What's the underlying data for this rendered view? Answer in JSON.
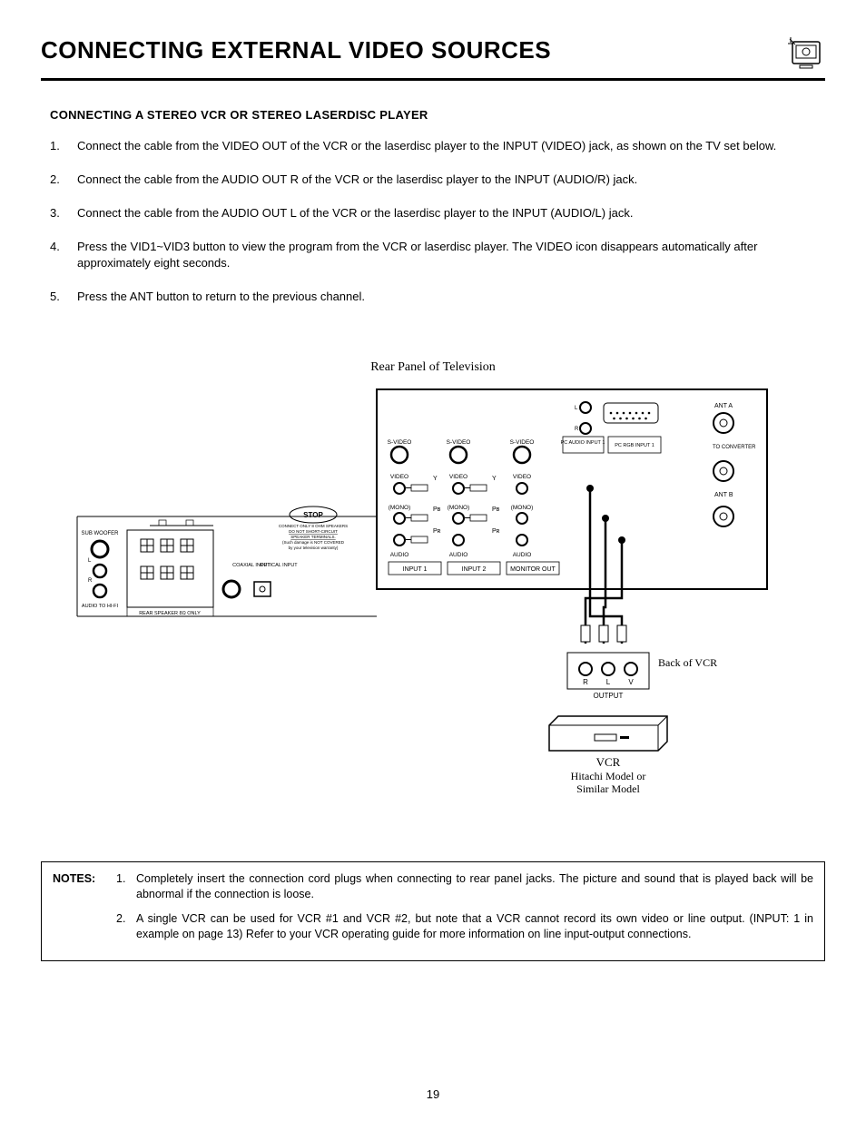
{
  "header": {
    "title": "CONNECTING EXTERNAL VIDEO SOURCES"
  },
  "section": {
    "title": "CONNECTING A STEREO VCR OR STEREO LASERDISC PLAYER"
  },
  "steps": [
    {
      "n": "1.",
      "text": "Connect the cable from the VIDEO OUT of the VCR or the laserdisc player to the INPUT (VIDEO) jack, as shown on the TV set below."
    },
    {
      "n": "2.",
      "text": "Connect the cable from the AUDIO OUT R of the VCR or the laserdisc player to the INPUT (AUDIO/R) jack."
    },
    {
      "n": "3.",
      "text": "Connect the cable from the AUDIO OUT L of the VCR or the laserdisc player to the INPUT (AUDIO/L) jack."
    },
    {
      "n": "4.",
      "text": "Press the VID1~VID3 button to view the program from the VCR or laserdisc player.  The VIDEO icon disappears automatically after approximately eight seconds."
    },
    {
      "n": "5.",
      "text": "Press the ANT button to return to the previous channel."
    }
  ],
  "diagram": {
    "caption": "Rear Panel of Television",
    "labels": {
      "svideo": "S-VIDEO",
      "video": "VIDEO",
      "mono": "(MONO)",
      "audio": "AUDIO",
      "l": "L",
      "r": "R",
      "y": "Y",
      "pb": "Pʙ",
      "pr": "Pʀ",
      "pc_audio_input1": "PC AUDIO INPUT 1",
      "pc_rgb_input1": "PC RGB INPUT 1",
      "ant_a": "ANT A",
      "to_converter": "TO CONVERTER",
      "ant_b": "ANT B",
      "input1": "INPUT 1",
      "input2": "INPUT 2",
      "monitor_out": "MONITOR OUT",
      "sub_woofer": "SUB WOOFER",
      "audio_to_hifi": "AUDIO TO HI-FI",
      "coaxial_input": "COAXIAL INPUT",
      "optical_input": "OPTICAL INPUT",
      "rear_speaker": "REAR SPEAKER 8Ω ONLY",
      "stop": "STOP",
      "stop_note1": "CONNECT ONLY 8 OHM SPEAKERS",
      "stop_note2": "DO NOT SHORT-CIRCUIT",
      "stop_note3": "SPEAKER TERMINALS.",
      "stop_note4": "(Such damage is NOT COVERED",
      "stop_note5": "by your television warranty)",
      "back_of_vcr": "Back of VCR",
      "output": "OUTPUT",
      "v": "V",
      "vcr": "VCR",
      "vcr_model1": "Hitachi Model or",
      "vcr_model2": "Similar Model"
    }
  },
  "notes": {
    "label": "NOTES:",
    "items": [
      {
        "n": "1.",
        "text": "Completely insert the connection cord plugs when connecting to rear panel jacks.  The picture and sound that is played back will be abnormal if the connection is loose."
      },
      {
        "n": "2.",
        "text": "A single VCR can be used for VCR #1 and VCR #2, but note that a VCR cannot record its own video or line output. (INPUT: 1 in example on page 13)  Refer to your VCR operating guide for more information on line input-output connections."
      }
    ]
  },
  "page_number": "19"
}
